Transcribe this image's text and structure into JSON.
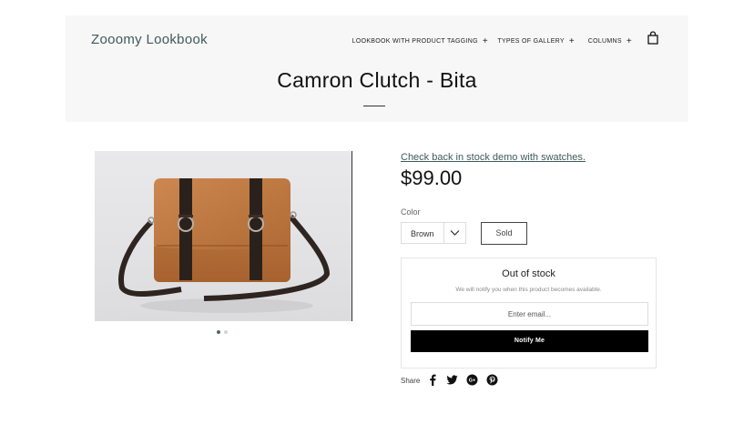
{
  "header": {
    "brand": "Zooomy Lookbook",
    "nav": [
      {
        "label": "LOOKBOOK WITH PRODUCT TAGGING",
        "icon": "plus-icon"
      },
      {
        "label": "TYPES OF GALLERY",
        "icon": "plus-icon"
      },
      {
        "label": "COLUMNS",
        "icon": "plus-icon"
      }
    ],
    "cart_icon": "shopping-bag-icon"
  },
  "page": {
    "title": "Camron Clutch - Bita"
  },
  "product": {
    "image_alt": "brown leather messenger bag",
    "gallery": {
      "count": 2,
      "active_index": 0
    },
    "stock_link": "Check back in stock demo with swatches.",
    "price": "$99.00",
    "color_label": "Color",
    "color_value": "Brown",
    "sold_label": "Sold"
  },
  "notify": {
    "title": "Out of stock",
    "subtitle": "We will notify you when this product becomes available.",
    "email_placeholder": "Enter email...",
    "button_label": "Notify Me"
  },
  "share": {
    "label": "Share",
    "icons": [
      "facebook-icon",
      "twitter-icon",
      "google-plus-icon",
      "pinterest-icon"
    ]
  },
  "colors": {
    "brand_teal": "#3f5a5a",
    "header_bg": "#f7f7f7",
    "button_black": "#000000",
    "bag_brown": "#b5703f"
  }
}
